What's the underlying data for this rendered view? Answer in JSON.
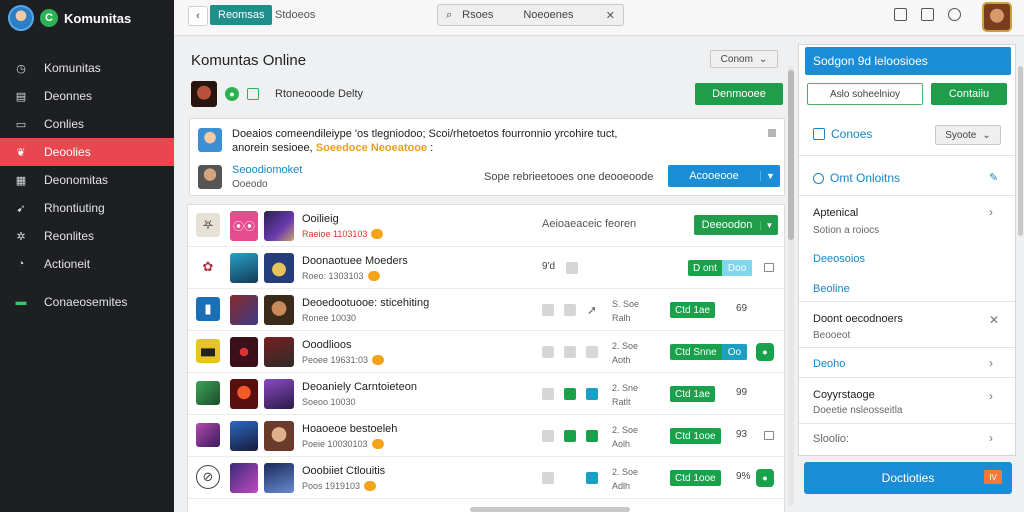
{
  "app": {
    "name": "Komunitas",
    "logo_letter": "C"
  },
  "sidebar": {
    "items": [
      {
        "label": "Komunitas",
        "icon": "clock-icon"
      },
      {
        "label": "Deonnes",
        "icon": "calendar-icon"
      },
      {
        "label": "Conlies",
        "icon": "card-icon"
      },
      {
        "label": "Deoolies",
        "icon": "people-icon",
        "active": true
      },
      {
        "label": "Deonomitas",
        "icon": "grid-icon"
      },
      {
        "label": "Rhontiuting",
        "icon": "pin-icon"
      },
      {
        "label": "Reonlites",
        "icon": "gear-icon"
      },
      {
        "label": "Actioneit",
        "icon": "clock-icon"
      },
      {
        "label": "Conaeosemites",
        "icon": "person-icon"
      }
    ]
  },
  "topbar": {
    "back": "‹",
    "tab_label": "Reomsas",
    "crumb": "Stdoeos",
    "search_left": "Rsoes",
    "search_mid": "Noeoenes",
    "search_clear": "✕"
  },
  "main": {
    "title": "Komuntas Online",
    "dropdown": "Conom",
    "info_text": "Rtoneooode Delty",
    "info_button": "Denmooee",
    "card": {
      "line1": "Doeaios comeendileiype 'os tlegniodoo;  Scoi/rhetoetos fourronnio yrcohire tuct,",
      "line2_plain": "anorein sesioee,",
      "line2_hl": "Soeedoce Neoeatooe",
      "line2_end": ":",
      "name": "Seoodiomoket",
      "sub": "Ooeodo",
      "hint": "Sope rebrieetooes one deooeoode",
      "button": "Acooeooe"
    },
    "rows": [
      {
        "title": "Ooilieig",
        "sub": "Raeioe 1103103",
        "action_type": "dropdown",
        "desc": "Aeioaeaceic feoren",
        "button": "Deeoodon"
      },
      {
        "title": "Doonaotuee Moeders",
        "sub": "Roeo: 1303103",
        "action_type": "pill",
        "count": "9'd",
        "pill_a": "D ont",
        "pill_b": "Doo",
        "end": "box"
      },
      {
        "title": "Deoedootuooe: sticehiting",
        "sub": "Ronee 10030",
        "action_type": "pill",
        "meta1": "S. Soe",
        "meta2": "Ralh",
        "pill_a": "Ctd 1ae",
        "count": "69",
        "end": "none"
      },
      {
        "title": "Ooodlioos",
        "sub": "Peoee 19631:03",
        "action_type": "pill",
        "meta1": "2. Soe",
        "meta2": "Aoth",
        "pill_a": "Ctd Snne",
        "pill_b": "Oo",
        "end": "circle"
      },
      {
        "title": "Deoaniely Carntoieteon",
        "sub": "Soeoo 10030",
        "action_type": "pill",
        "meta1": "2. Sne",
        "meta2": "Ratlt",
        "pill_a": "Ctd 1ae",
        "count": "99",
        "end": "none"
      },
      {
        "title": "Hoaoeoe bestoeleh",
        "sub": "Poeie 10030103",
        "action_type": "pill",
        "meta1": "2. Soe",
        "meta2": "Aolh",
        "pill_a": "Ctd 1ooe",
        "count": "93",
        "end": "box"
      },
      {
        "title": "Ooobiiet Ctlouitis",
        "sub": "Poos 1919103",
        "action_type": "pill",
        "meta1": "2. Soe",
        "meta2": "Adlh",
        "pill_a": "Ctd 1ooe",
        "count": "9%",
        "end": "circle"
      }
    ]
  },
  "rpanel": {
    "header": "Sodgon 9d leloosioes",
    "input": "Aslo soheelnioy",
    "button": "Contaiiu",
    "section1": "Conoes",
    "section1_dd": "Syoote",
    "section2": "Omt Onloitns",
    "items": [
      {
        "label": "Aptenical",
        "sub": "Sotion a roiocs",
        "chev": "›",
        "blue": false
      },
      {
        "label": "Deeosoios",
        "blue": true
      },
      {
        "label": "Beoline",
        "blue": true
      },
      {
        "label": "Doont oecodnoers",
        "sub": "Beooeot",
        "chev": "✕",
        "blue": false
      },
      {
        "label": "Deoho",
        "chev": "›",
        "blue": true
      },
      {
        "label": "Coyyrstaoge",
        "sub": "Doeetie nsleosseitla",
        "chev": "›",
        "blue": false
      },
      {
        "label": "Sloolio:",
        "chev": "›",
        "blue": false
      }
    ],
    "bottom_button": "Doctioties",
    "bottom_badge": "IV"
  }
}
